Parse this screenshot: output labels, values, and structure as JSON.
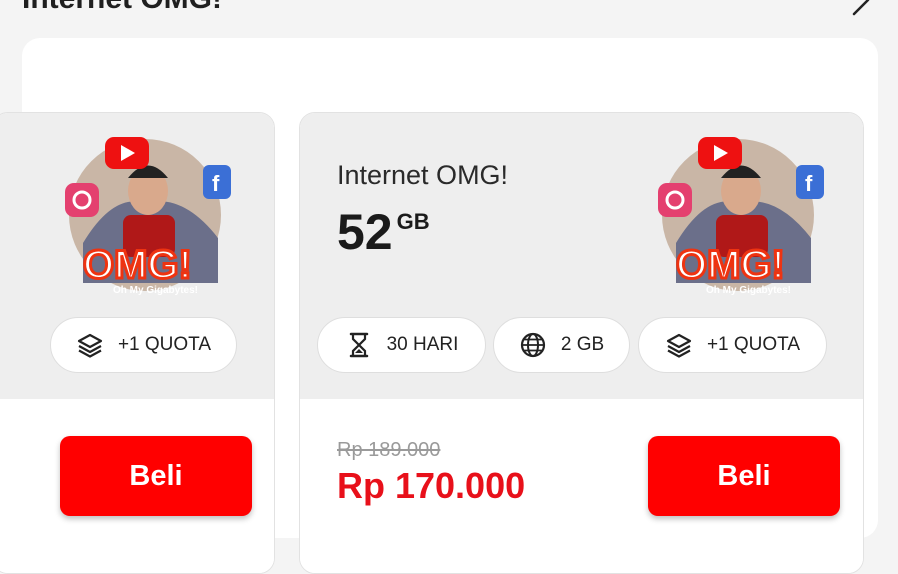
{
  "section": {
    "title": "Internet OMG!"
  },
  "packages": [
    {
      "promo": {
        "logo_text": "OMG!",
        "tagline": "Oh My Gigabytes!"
      },
      "chips": [
        {
          "icon": "layers-icon",
          "label": "+1 QUOTA"
        }
      ],
      "buy_label": "Beli"
    },
    {
      "name": "Internet OMG!",
      "size_value": "52",
      "size_unit": "GB",
      "promo": {
        "logo_text": "OMG!",
        "tagline": "Oh My Gigabytes!"
      },
      "chips": [
        {
          "icon": "hourglass-icon",
          "label": "30 HARI"
        },
        {
          "icon": "globe-icon",
          "label": "2 GB"
        },
        {
          "icon": "layers-icon",
          "label": "+1 QUOTA"
        }
      ],
      "old_price": "Rp 189.000",
      "price": "Rp 170.000",
      "buy_label": "Beli"
    }
  ],
  "colors": {
    "accent": "#ff0000",
    "price": "#e8101a"
  }
}
